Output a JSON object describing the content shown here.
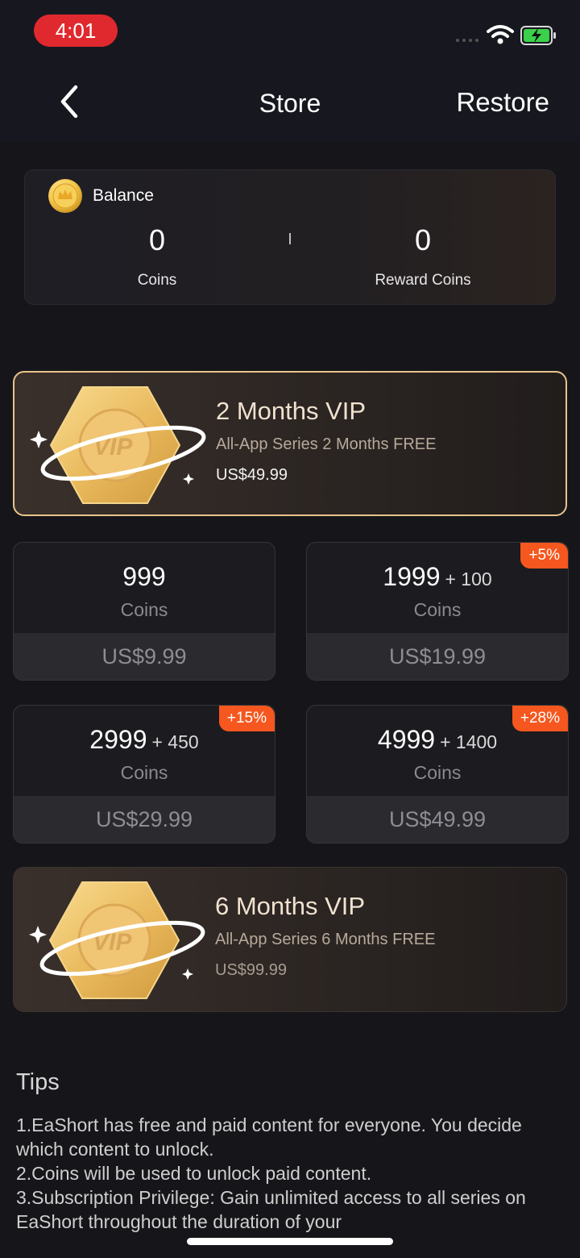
{
  "status_bar": {
    "time": "4:01"
  },
  "header": {
    "title": "Store",
    "restore_label": "Restore"
  },
  "balance": {
    "label": "Balance",
    "coins_value": "0",
    "coins_label": "Coins",
    "reward_value": "0",
    "reward_label": "Reward Coins"
  },
  "vip_offers": [
    {
      "badge_text": "VIP",
      "title": "2 Months VIP",
      "subtitle": "All-App Series 2 Months FREE",
      "price": "US$49.99",
      "selected": true
    },
    {
      "badge_text": "VIP",
      "title": "6 Months VIP",
      "subtitle": "All-App Series 6 Months FREE",
      "price": "US$99.99",
      "selected": false
    }
  ],
  "coin_packs": [
    {
      "amount": "999",
      "bonus": "",
      "unit": "Coins",
      "price": "US$9.99",
      "tag": ""
    },
    {
      "amount": "1999",
      "bonus": "+ 100",
      "unit": "Coins",
      "price": "US$19.99",
      "tag": "+5%"
    },
    {
      "amount": "2999",
      "bonus": "+ 450",
      "unit": "Coins",
      "price": "US$29.99",
      "tag": "+15%"
    },
    {
      "amount": "4999",
      "bonus": "+ 1400",
      "unit": "Coins",
      "price": "US$49.99",
      "tag": "+28%"
    }
  ],
  "tips": {
    "title": "Tips",
    "lines": [
      "1.EaShort has free and paid content for everyone. You decide which content to unlock.",
      "2.Coins will be used to unlock paid content.",
      "3.Subscription Privilege: Gain unlimited access to all series on EaShort throughout the duration of your"
    ]
  },
  "colors": {
    "background": "#16161a",
    "accent_gold": "#e8c48a",
    "tag_orange": "#f5571e",
    "status_pill": "#e0292e"
  },
  "icons": {
    "back": "chevron-left-icon",
    "coin": "coin-icon",
    "vip_badge": "vip-badge-icon",
    "wifi": "wifi-icon",
    "battery": "battery-charging-icon"
  }
}
